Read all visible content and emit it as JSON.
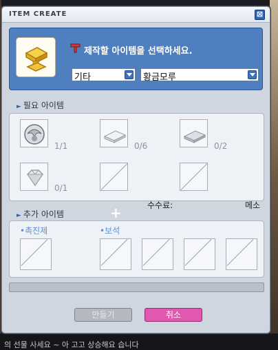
{
  "window": {
    "title": "ITEM CREATE",
    "close_symbol": "⊠"
  },
  "header": {
    "instruction": "제작할 아이템을 선택하세요.",
    "category_select": "기타",
    "item_select": "황금모루"
  },
  "required": {
    "label": "필요 아이템",
    "slots": [
      {
        "icon": "shell-icon",
        "count": "1/1"
      },
      {
        "icon": "silver-plate-icon",
        "count": "0/6"
      },
      {
        "icon": "steel-plate-icon",
        "count": "0/2"
      },
      {
        "icon": "diamond-icon",
        "count": "0/1"
      },
      {
        "icon": "empty-slot-icon",
        "count": ""
      },
      {
        "icon": "empty-slot-icon",
        "count": ""
      }
    ]
  },
  "fee": {
    "label": "수수료:",
    "value": "메소"
  },
  "extra": {
    "label": "추가 아이템",
    "catalyst_label": "•촉진제",
    "gem_label": "•보석"
  },
  "buttons": {
    "make": "만들기",
    "cancel": "취소"
  },
  "background": {
    "bottom_text": "의 선물 사세요 ~ 아 고고 상승해요 습니다"
  },
  "colors": {
    "header_blue": "#4f7fbf",
    "cancel_pink": "#e158b0",
    "panel_gray": "#cfd6e0"
  }
}
